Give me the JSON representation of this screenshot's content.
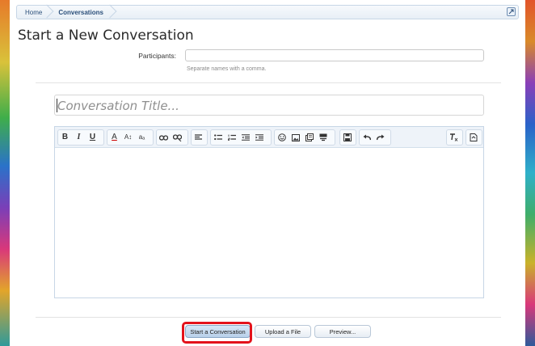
{
  "breadcrumb": {
    "home": "Home",
    "current": "Conversations"
  },
  "page_title": "Start a New Conversation",
  "participants": {
    "label": "Participants:",
    "value": "",
    "help": "Separate names with a comma."
  },
  "conversation_title": {
    "placeholder": "Conversation Title..."
  },
  "toolbar": {
    "bold": "B",
    "italic": "I",
    "underline": "U",
    "font_color": "A",
    "font_size": "A↕",
    "font_family": "aₐ"
  },
  "actions": {
    "start_conversation": "Start a Conversation",
    "upload_file": "Upload a File",
    "preview": "Preview..."
  },
  "colors": {
    "accent": "#2b4f7a",
    "highlight": "#e3121b"
  }
}
